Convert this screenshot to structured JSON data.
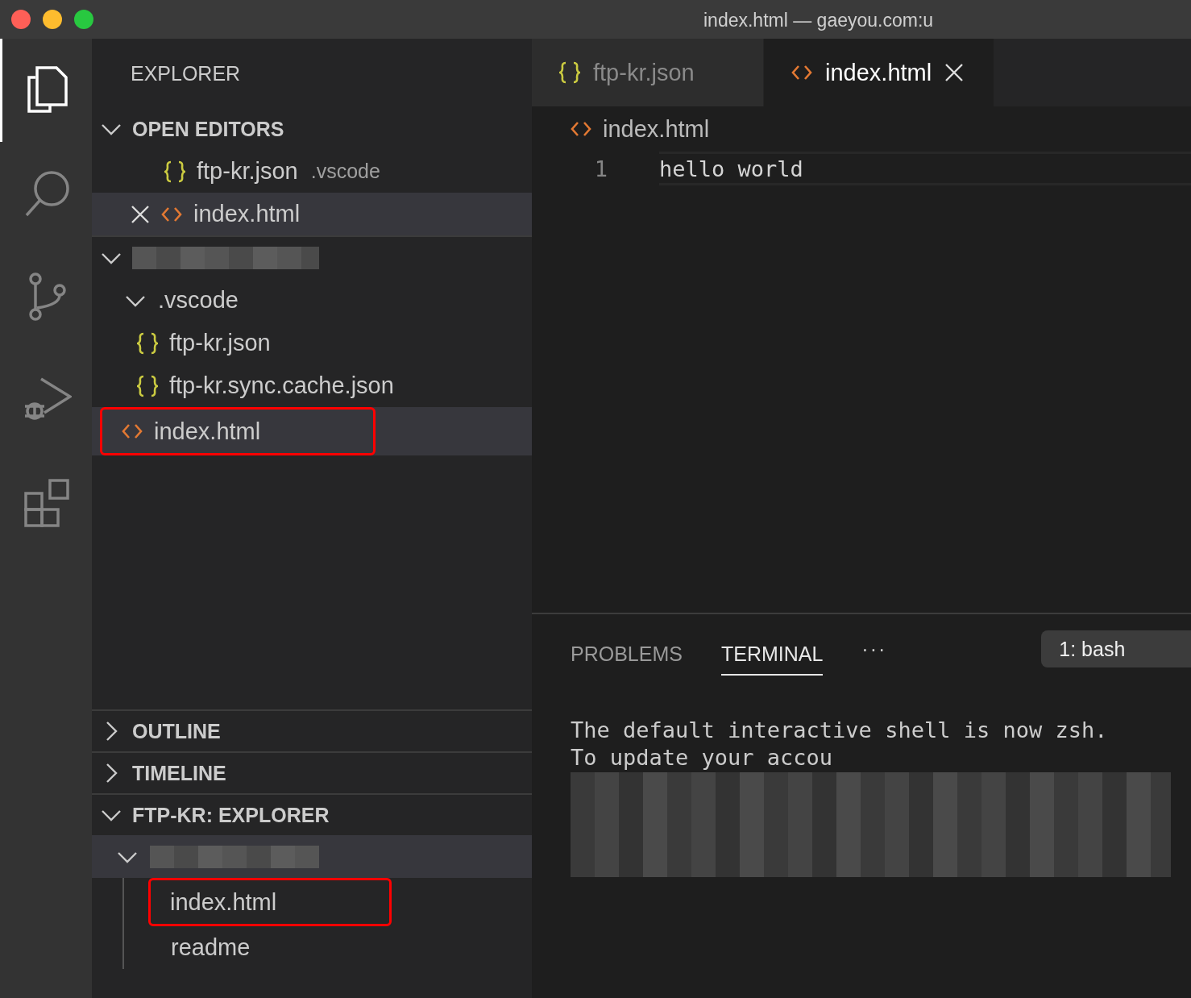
{
  "window": {
    "title": "index.html — gaeyou.com:u"
  },
  "activity_bar": [
    {
      "kind": "files",
      "selected": true
    },
    {
      "kind": "search",
      "selected": false
    },
    {
      "kind": "scm",
      "selected": false
    },
    {
      "kind": "debug",
      "selected": false
    },
    {
      "kind": "extensions",
      "selected": false
    }
  ],
  "sidebar": {
    "title": "EXPLORER",
    "sections": [
      {
        "title": "OPEN EDITORS",
        "expanded": true,
        "items": [
          {
            "kind": "json",
            "name": "ftp-kr.json",
            "path": ".vscode",
            "selected": false,
            "highlighted": false,
            "closable": false
          },
          {
            "kind": "html",
            "name": "index.html",
            "selected": true,
            "highlighted": false,
            "closable": true
          }
        ]
      },
      {
        "kind": "redacted",
        "expanded": true,
        "items": [
          {
            "kind": "folder",
            "name": ".vscode",
            "expanded": true,
            "selected": false,
            "highlighted": false,
            "children": [
              {
                "kind": "json",
                "name": "ftp-kr.json",
                "selected": false,
                "highlighted": false
              },
              {
                "kind": "json",
                "name": "ftp-kr.sync.cache.json",
                "selected": false,
                "highlighted": false
              }
            ]
          },
          {
            "kind": "html",
            "name": "index.html",
            "selected": true,
            "highlighted": true
          }
        ]
      }
    ],
    "bottom_sections": [
      {
        "title": "OUTLINE",
        "expanded": false
      },
      {
        "title": "TIMELINE",
        "expanded": false
      },
      {
        "title": "FTP-KR: EXPLORER",
        "expanded": true,
        "folder_selected": true,
        "items": [
          {
            "name": "index.html",
            "selected": false,
            "highlighted": true
          },
          {
            "name": "readme",
            "selected": false,
            "highlighted": false
          }
        ]
      }
    ]
  },
  "tabs": [
    {
      "kind": "json",
      "label": "ftp-kr.json",
      "selected": false
    },
    {
      "kind": "html",
      "label": "index.html",
      "selected": true
    }
  ],
  "breadcrumb": {
    "kind": "html",
    "label": "index.html"
  },
  "editor": {
    "lines": [
      {
        "number": "1",
        "text": "hello world"
      }
    ]
  },
  "panel": {
    "tabs": [
      {
        "label": "PROBLEMS",
        "selected": false
      },
      {
        "label": "TERMINAL",
        "selected": true
      }
    ],
    "more": "···",
    "terminal_select": "1: bash",
    "terminal_lines": [
      "The default interactive shell is now zsh.",
      "To update your accou"
    ]
  }
}
